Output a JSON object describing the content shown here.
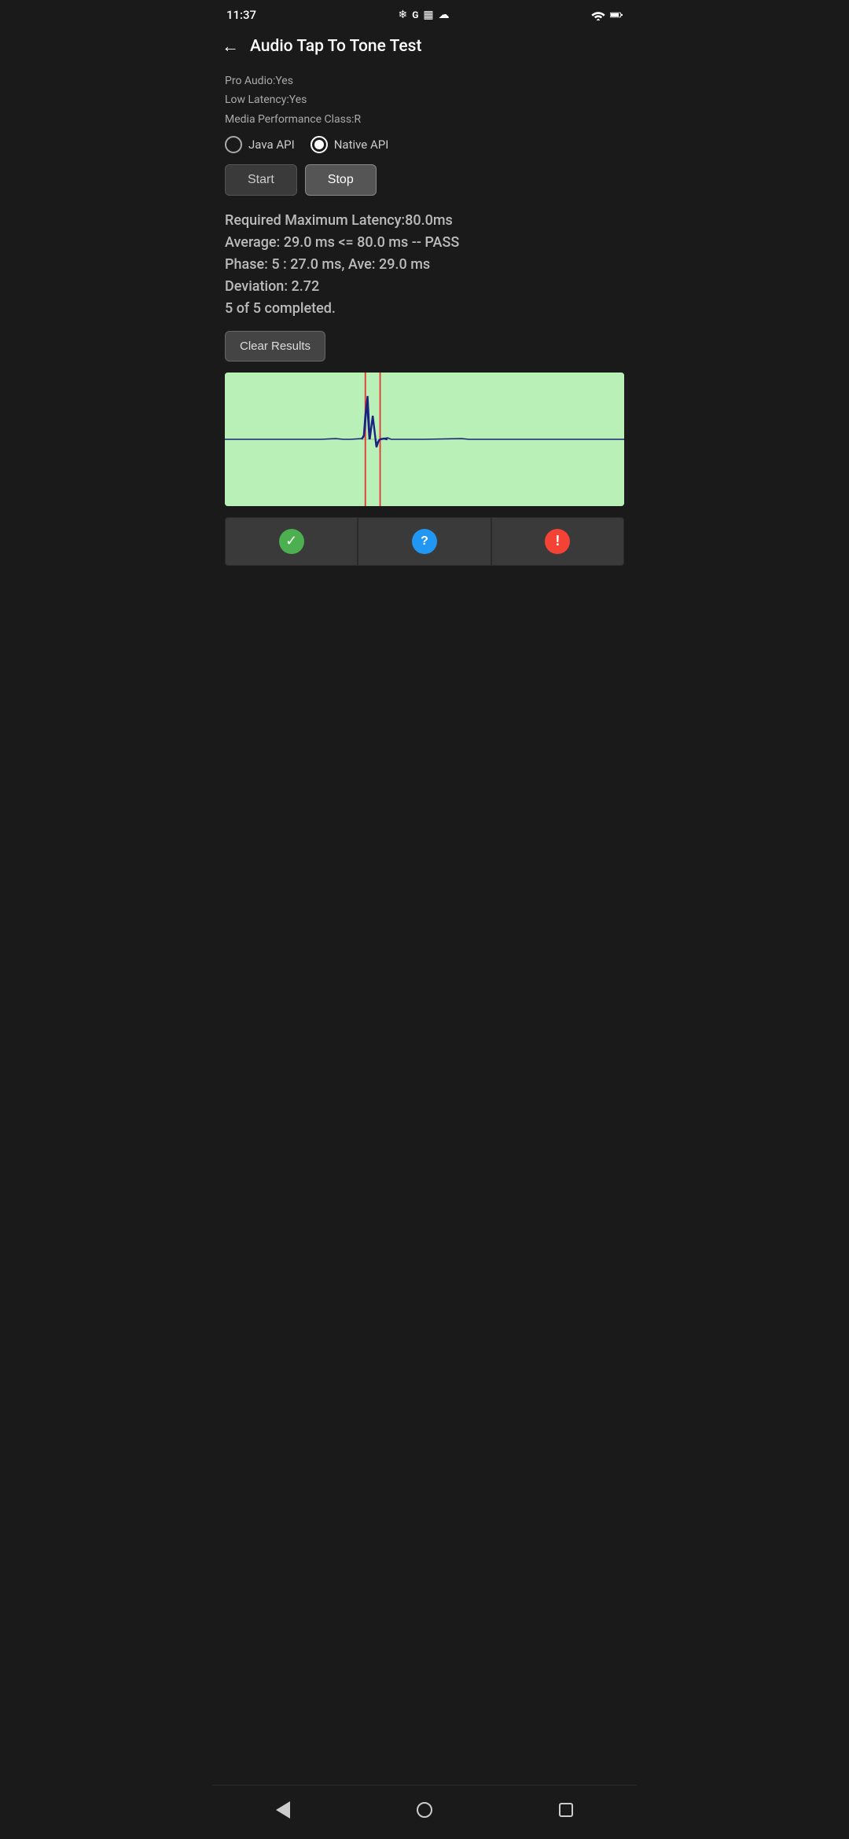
{
  "statusBar": {
    "time": "11:37",
    "leftIcons": [
      "fan-icon",
      "google-icon",
      "calendar-icon",
      "cloud-icon"
    ],
    "rightIcons": [
      "wifi-icon",
      "battery-icon"
    ]
  },
  "appBar": {
    "backLabel": "←",
    "title": "Audio Tap To Tone Test"
  },
  "info": {
    "proAudio": "Pro Audio:Yes",
    "lowLatency": "Low Latency:Yes",
    "mediaPerformance": "Media Performance Class:R"
  },
  "radioGroup": {
    "options": [
      "Java API",
      "Native API"
    ],
    "selected": "Native API"
  },
  "buttons": {
    "start": "Start",
    "stop": "Stop"
  },
  "results": {
    "line1": "Required Maximum Latency:80.0ms",
    "line2": "Average: 29.0 ms <= 80.0 ms -- PASS",
    "line3": "Phase: 5 : 27.0 ms, Ave: 29.0 ms",
    "line4": "Deviation: 2.72",
    "line5": "5 of 5 completed."
  },
  "clearButton": "Clear Results",
  "actionButtons": {
    "pass": "✓",
    "question": "?",
    "error": "!"
  },
  "navBar": {
    "back": "back",
    "home": "home",
    "recents": "recents"
  }
}
